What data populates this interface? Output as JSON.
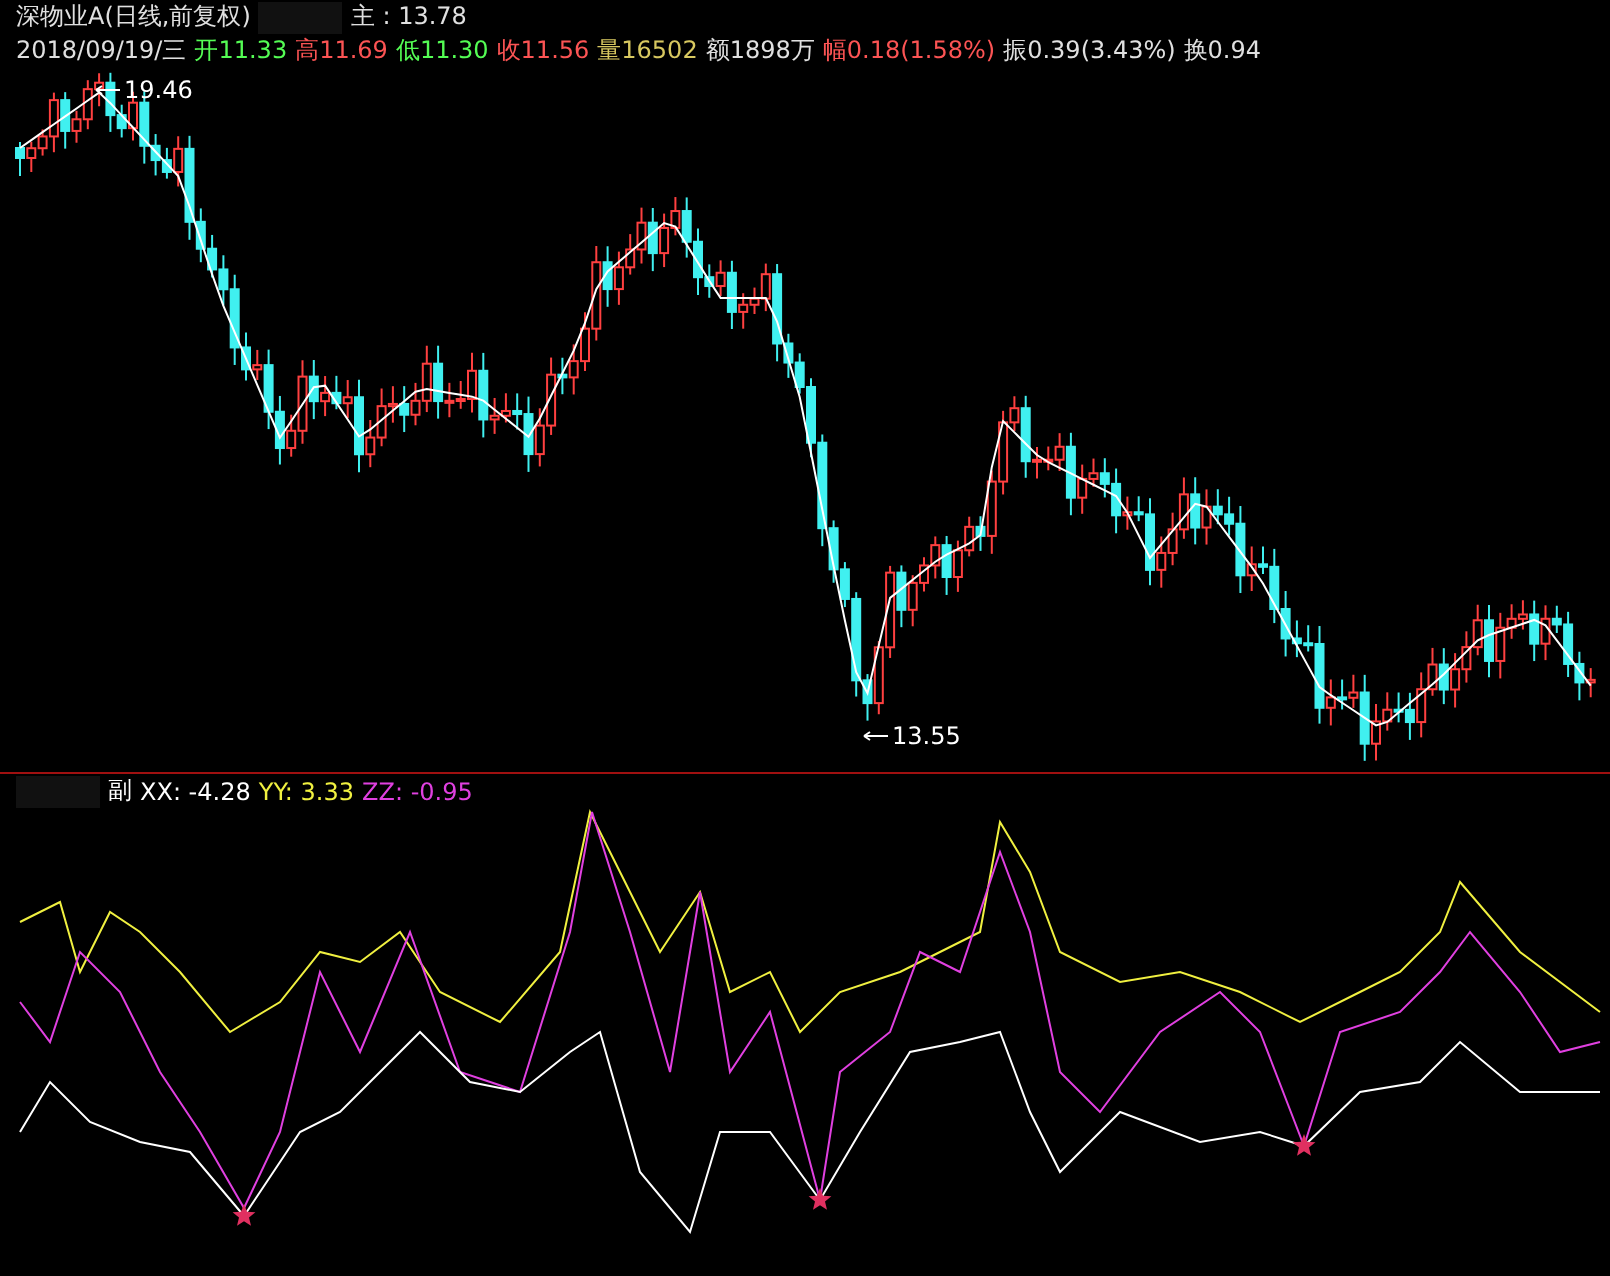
{
  "main_chart": {
    "title": "深物业A(日线,前复权)",
    "indicator": "主 : 13.78",
    "quote": [
      {
        "text": "2018/09/19/三",
        "color": "#e0e0e0"
      },
      {
        "text": "开11.33",
        "color": "#54fc54"
      },
      {
        "text": "高11.69",
        "color": "#fc5454"
      },
      {
        "text": "低11.30",
        "color": "#54fc54"
      },
      {
        "text": "收11.56",
        "color": "#fc5454"
      },
      {
        "text": "量16502",
        "color": "#d8c860"
      },
      {
        "text": "额1898万",
        "color": "#e0e0e0"
      },
      {
        "text": "幅0.18(1.58%)",
        "color": "#fc5454"
      },
      {
        "text": "振0.39(3.43%)",
        "color": "#e0e0e0"
      },
      {
        "text": "换0.94",
        "color": "#e0e0e0"
      }
    ],
    "high_label": "19.46",
    "low_label": "13.55"
  },
  "sub_chart": {
    "title": "副",
    "values": [
      {
        "text": "XX: -4.28",
        "color": "#ffffff"
      },
      {
        "text": "YY: 3.33",
        "color": "#f0f040"
      },
      {
        "text": "ZZ: -0.95",
        "color": "#e040e0"
      }
    ]
  }
}
